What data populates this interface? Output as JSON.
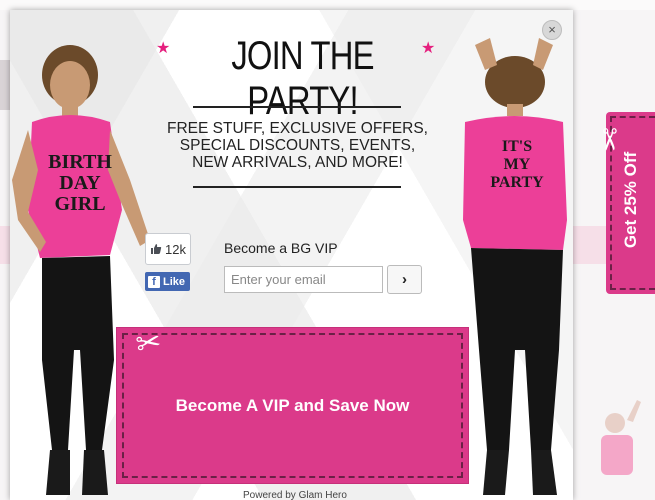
{
  "modal": {
    "close_label": "×",
    "headline": "JOIN THE PARTY!",
    "star_glyph": "★",
    "subtext": "FREE STUFF, EXCLUSIVE OFFERS, SPECIAL DISCOUNTS, EVENTS, NEW ARRIVALS, AND MORE!",
    "like_count": "12k",
    "like_label": "Like",
    "vip_label": "Become a BG VIP",
    "email_placeholder": "Enter your email",
    "submit_label": "›",
    "coupon_label": "Become A VIP and Save Now",
    "powered_by": "Powered by Glam Hero",
    "left_shirt_text": [
      "BIRTH",
      "DAY",
      "GIRL"
    ],
    "right_shirt_text": [
      "IT'S",
      "MY",
      "PARTY"
    ]
  },
  "side_tab": {
    "label": "Get 25% Off"
  },
  "colors": {
    "accent_pink": "#db3a8a",
    "facebook_blue": "#4267b2",
    "star_pink": "#e5207e"
  },
  "icons": {
    "close": "close-icon",
    "thumbs_up": "thumbs-up-icon",
    "facebook": "facebook-icon",
    "arrow": "chevron-right-icon",
    "scissors": "scissors-icon"
  }
}
